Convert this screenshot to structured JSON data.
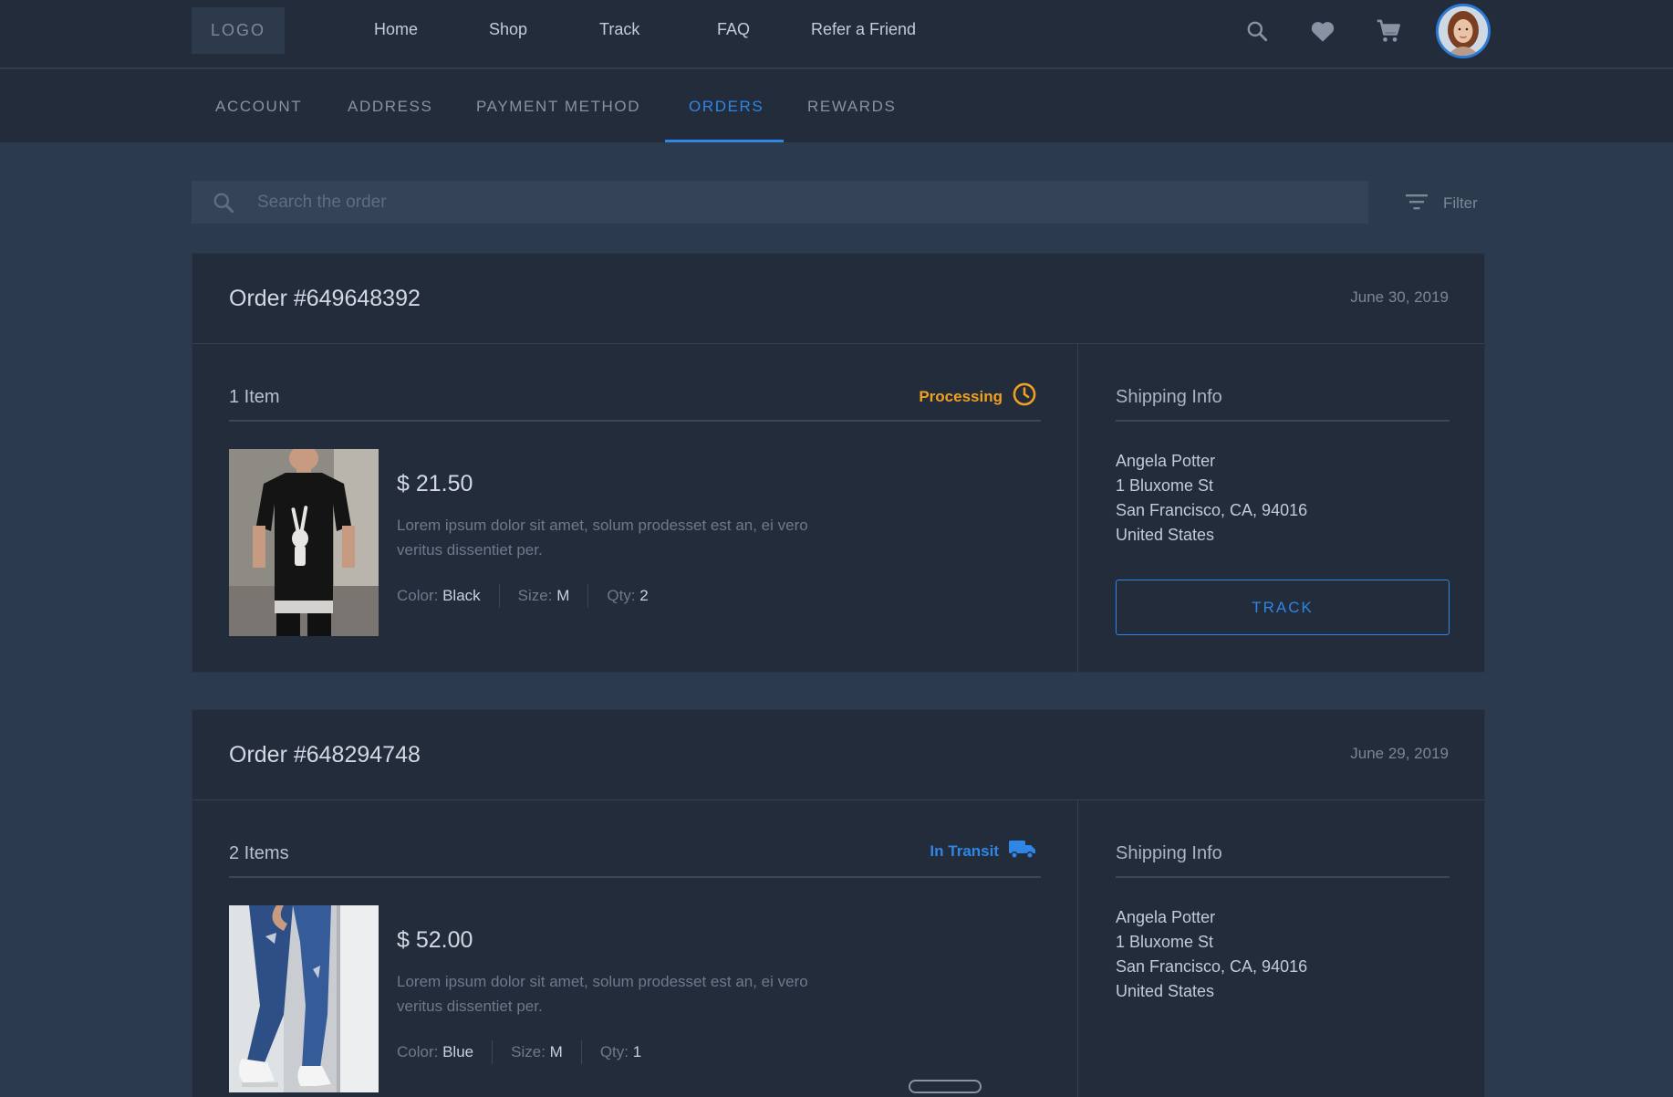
{
  "header": {
    "logo": "LOGO",
    "nav": [
      "Home",
      "Shop",
      "Track",
      "FAQ",
      "Refer a Friend"
    ],
    "icons": [
      "search-icon",
      "heart-icon",
      "cart-icon"
    ]
  },
  "tabs": [
    "ACCOUNT",
    "ADDRESS",
    "PAYMENT METHOD",
    "ORDERS",
    "REWARDS"
  ],
  "active_tab": "ORDERS",
  "search": {
    "placeholder": "Search the order"
  },
  "filter_label": "Filter",
  "colors": {
    "accent": "#2f86e6",
    "processing": "#f0a020",
    "in_transit": "#2f86e6"
  },
  "orders": [
    {
      "number": "Order #649648392",
      "date": "June 30, 2019",
      "items_count": "1 Item",
      "status": "Processing",
      "status_icon": "clock-icon",
      "item": {
        "price": "$ 21.50",
        "description": "Lorem ipsum dolor sit amet, solum prodesset est an, ei vero veritus dissentiet per.",
        "color_label": "Color:",
        "color": "Black",
        "size_label": "Size:",
        "size": "M",
        "qty_label": "Qty:",
        "qty": "2"
      },
      "shipping": {
        "title": "Shipping Info",
        "name": "Angela Potter",
        "street": "1 Bluxome St",
        "city": "San Francisco, CA, 94016",
        "country": "United States"
      },
      "action": "TRACK"
    },
    {
      "number": "Order #648294748",
      "date": "June 29, 2019",
      "items_count": "2 Items",
      "status": "In Transit",
      "status_icon": "truck-icon",
      "item": {
        "price": "$ 52.00",
        "description": "Lorem ipsum dolor sit amet, solum prodesset est an, ei vero veritus dissentiet per.",
        "color_label": "Color:",
        "color": "Blue",
        "size_label": "Size:",
        "size": "M",
        "qty_label": "Qty:",
        "qty": "1"
      },
      "shipping": {
        "title": "Shipping Info",
        "name": "Angela Potter",
        "street": "1 Bluxome St",
        "city": "San Francisco, CA, 94016",
        "country": "United States"
      }
    }
  ]
}
